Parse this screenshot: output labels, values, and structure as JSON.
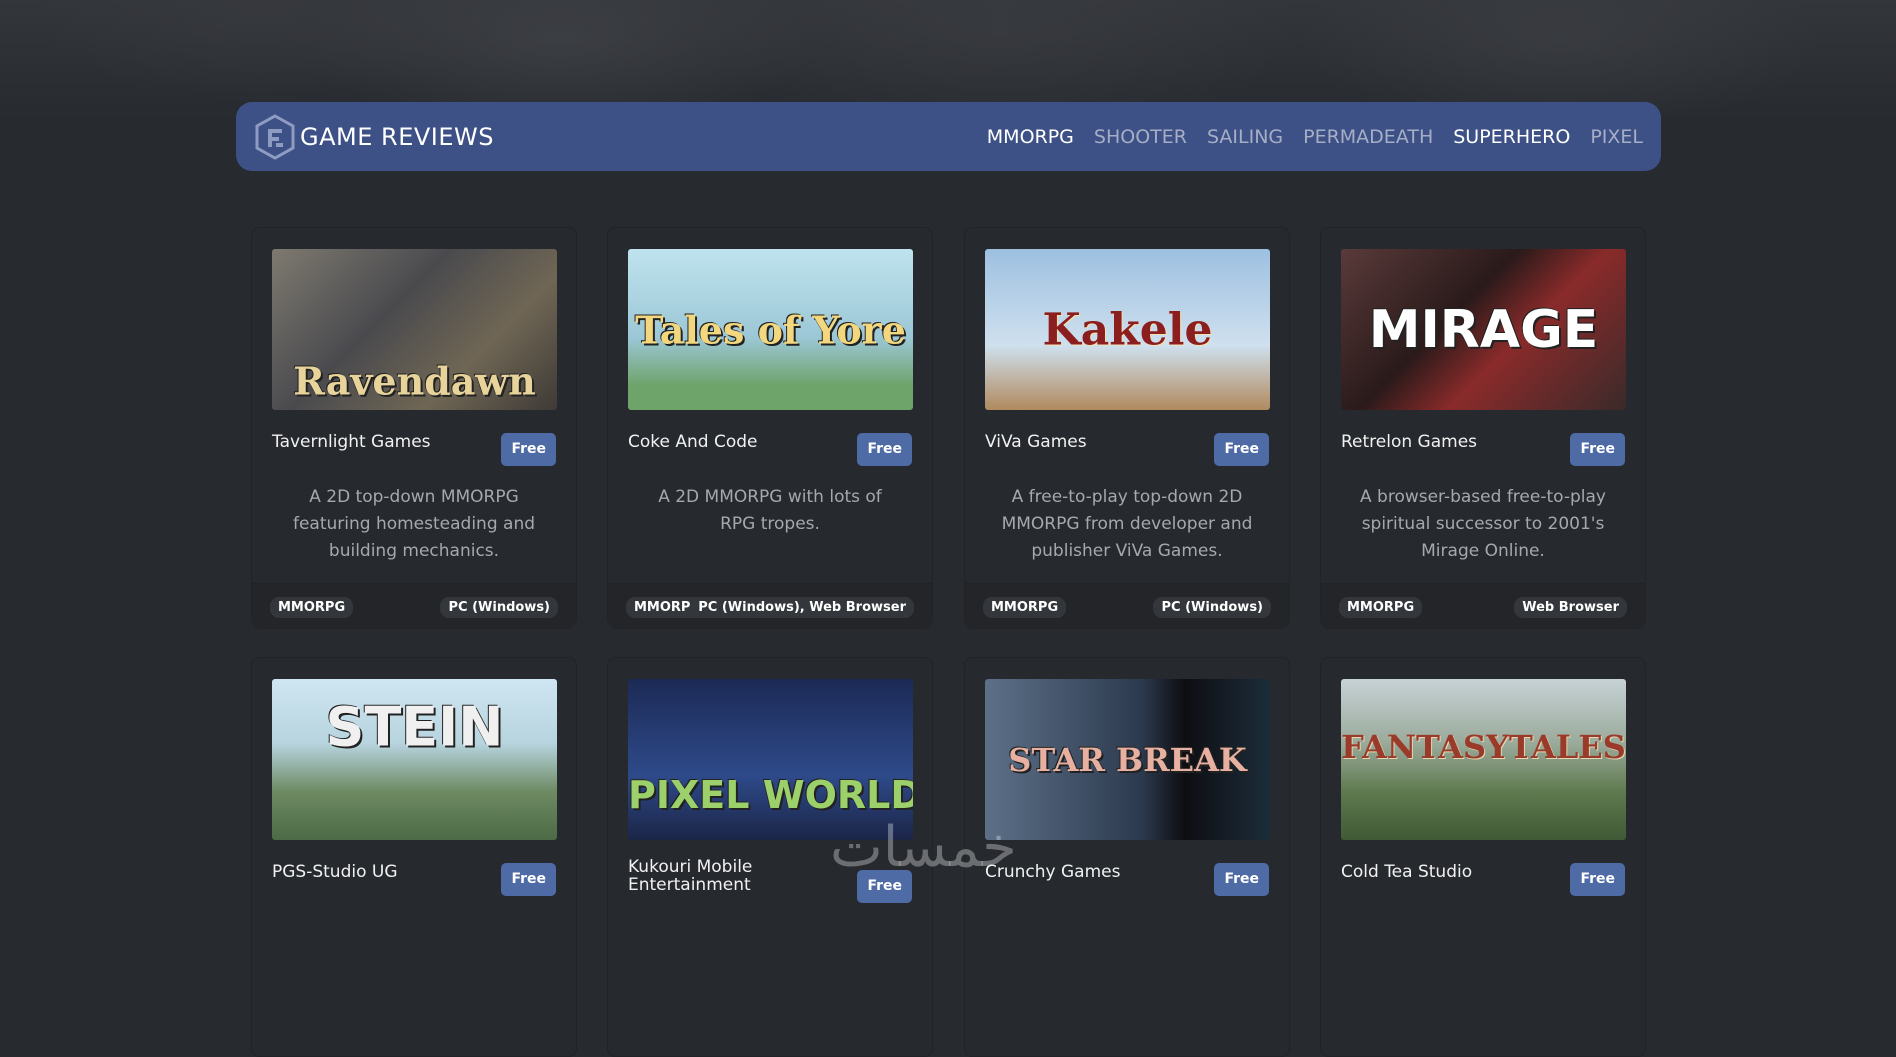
{
  "brand": {
    "title": "GAME REVIEWS"
  },
  "nav": [
    {
      "label": "MMORPG",
      "active": true
    },
    {
      "label": "SHOOTER",
      "active": false
    },
    {
      "label": "SAILING",
      "active": false
    },
    {
      "label": "PERMADEATH",
      "active": false
    },
    {
      "label": "SUPERHERO",
      "active": true
    },
    {
      "label": "PIXEL",
      "active": false
    }
  ],
  "games": [
    {
      "thumb_title": "Ravendawn",
      "developer": "Tavernlight Games",
      "price": "Free",
      "description": "A 2D top-down MMORPG featuring homesteading and building mechanics.",
      "genre": "MMORPG",
      "platform": "PC (Windows)"
    },
    {
      "thumb_title": "Tales of Yore",
      "developer": "Coke And Code",
      "price": "Free",
      "description": "A 2D MMORPG with lots of RPG tropes.",
      "genre": "MMORPG",
      "platform": "PC (Windows), Web Browser"
    },
    {
      "thumb_title": "Kakele",
      "developer": "ViVa Games",
      "price": "Free",
      "description": "A free-to-play top-down 2D MMORPG from developer and publisher ViVa Games.",
      "genre": "MMORPG",
      "platform": "PC (Windows)"
    },
    {
      "thumb_title": "MIRAGE",
      "developer": "Retrelon Games",
      "price": "Free",
      "description": "A browser-based free-to-play spiritual successor to 2001's Mirage Online.",
      "genre": "MMORPG",
      "platform": "Web Browser"
    },
    {
      "thumb_title": "STEIN",
      "developer": "PGS-Studio UG",
      "price": "Free"
    },
    {
      "thumb_title": "PIXEL WORLDS",
      "developer": "Kukouri Mobile Entertainment",
      "price": "Free"
    },
    {
      "thumb_title": "STAR BREAK",
      "developer": "Crunchy Games",
      "price": "Free"
    },
    {
      "thumb_title": "FANTASYTALES",
      "developer": "Cold Tea Studio",
      "price": "Free"
    }
  ],
  "colors": {
    "page_bg": "#272b30",
    "navbar_bg": "#3d5187",
    "price_badge": "#4f6ba6",
    "card_bg": "#26292e"
  },
  "watermark": "خمسات"
}
